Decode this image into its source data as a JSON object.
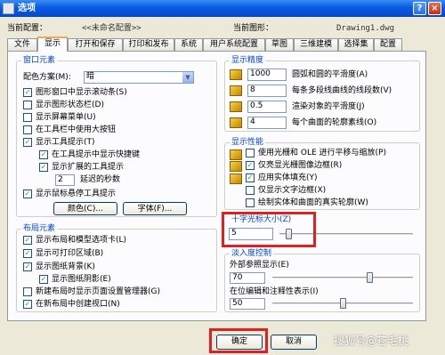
{
  "window": {
    "title": "选项"
  },
  "profile": {
    "label": "当前配置：",
    "value": "<<未命名配置>>",
    "drawing_label": "当前图形：",
    "drawing_value": "Drawing1.dwg"
  },
  "tabs": [
    "文件",
    "显示",
    "打开和保存",
    "打印和发布",
    "系统",
    "用户系统配置",
    "草图",
    "三维建模",
    "选择集",
    "配置"
  ],
  "window_elements": {
    "title": "窗口元素",
    "color_scheme_label": "配色方案(M):",
    "color_scheme_value": "暗",
    "items": {
      "scrollbars": "图形窗口中显示滚动条(S)",
      "status_bar": "显示图形状态栏(D)",
      "screen_menu": "显示屏幕菜单(U)",
      "large_buttons": "在工具栏中使用大按钮",
      "tooltips": "显示工具提示(T)",
      "shortcut_keys": "在工具提示中显示快捷键",
      "extended_tooltips": "显示扩展的工具提示",
      "delay_seconds": "延迟的秒数",
      "rollover": "显示鼠标悬停工具提示"
    },
    "delay_value": "2",
    "colors_button": "颜色(C)...",
    "fonts_button": "字体(F)..."
  },
  "layout_elements": {
    "title": "布局元素",
    "items": {
      "layout_tabs": "显示布局和模型选项卡(L)",
      "printable_area": "显示可打印区域(B)",
      "paper_background": "显示图纸背景(K)",
      "paper_shadow": "显示图纸阴影(E)",
      "page_setup": "新建布局时显示页面设置管理器(G)",
      "viewport": "在新布局中创建视口(N)"
    }
  },
  "display_resolution": {
    "title": "显示精度",
    "rows": [
      {
        "value": "1000",
        "label": "圆弧和圆的平滑度(A)"
      },
      {
        "value": "8",
        "label": "每条多段线曲线的线段数(V)"
      },
      {
        "value": "0.5",
        "label": "渲染对象的平滑度(J)"
      },
      {
        "value": "4",
        "label": "每个曲面的轮廓素线(O)"
      }
    ]
  },
  "display_performance": {
    "title": "显示性能",
    "items": {
      "raster_ole": "使用光栅和 OLE 进行平移与缩放(P)",
      "raster_frame": "仅亮显光栅图像边框(R)",
      "solid_fill": "应用实体填充(Y)",
      "text_frame": "仅显示文字边框(X)",
      "silhouettes": "绘制实体和曲面的真实轮廓(W)"
    }
  },
  "crosshair": {
    "title": "十字光标大小(Z)",
    "value": "5",
    "level_percent": 5
  },
  "fade_control": {
    "title": "淡入度控制",
    "xref_label": "外部参照显示(E)",
    "xref_value": "70",
    "xref_percent": 70,
    "inplace_label": "在位编辑和注释性表示(I)",
    "inplace_value": "50",
    "inplace_percent": 50
  },
  "buttons": {
    "ok": "确定",
    "cancel": "取消"
  },
  "watermark": "搜狐号@苍毛桃",
  "colors": {
    "accent": "#0046d5",
    "highlight": "#e02020"
  }
}
